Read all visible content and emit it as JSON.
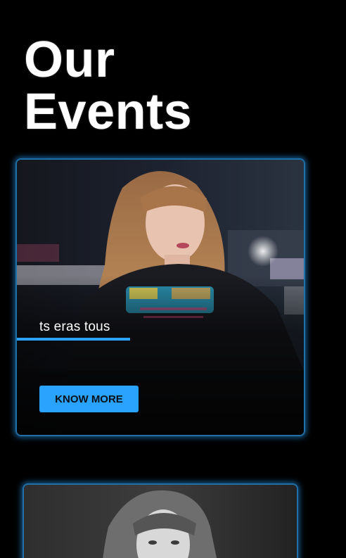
{
  "page": {
    "heading_line1": "Our",
    "heading_line2": "Events"
  },
  "events": [
    {
      "title": "ts eras tous",
      "button_label": "KNOW MORE",
      "image": "portrait-photo-color"
    },
    {
      "image": "portrait-photo-bw"
    }
  ],
  "colors": {
    "background": "#000000",
    "accent": "#29a3ff",
    "text": "#ffffff",
    "card_border": "#1f6fa8"
  }
}
